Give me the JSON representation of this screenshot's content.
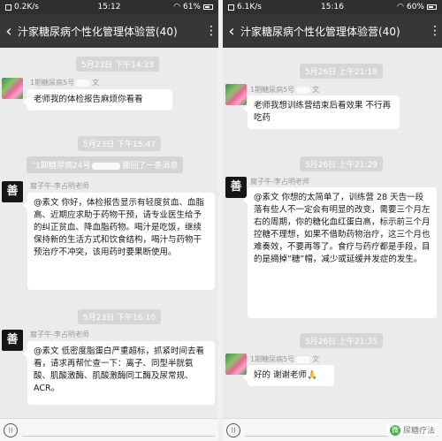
{
  "left": {
    "status_bar": {
      "network": "0.2K/s",
      "time": "15:12",
      "battery": "61%"
    },
    "title_bar": {
      "back": "‹",
      "title": "汁家糖尿病个性化管理体验营(40)",
      "menu": "⋮"
    },
    "messages": [
      {
        "type": "timestamp",
        "text": "5月23日 下午14:33"
      },
      {
        "type": "message",
        "sender_prefix": "1期糖尿病5号",
        "sender_suffix": "文",
        "text": "老师我的体检报告麻烦你看看"
      },
      {
        "type": "timestamp",
        "text": "5月23日 下午15:47"
      },
      {
        "type": "notice",
        "text_prefix": "\"1期糖尿病24号",
        "text_suffix": "撤回了一条消息"
      },
      {
        "type": "message",
        "sender": "腐子牛-李占明老师",
        "text": "@素文  你好，体检报告显示有轻度贫血、血脂高、近期应求助于药物干预，请专业医生给予的纠正贫血、降血脂药物。喝汁是吃饭，继续保持新的生活方式和饮食结构，喝汁与药物干预治疗不冲突，该用药时要果断使用。"
      },
      {
        "type": "timestamp",
        "text": "5月23日 下午16:10"
      },
      {
        "type": "message",
        "sender": "腐子牛-李占明老师",
        "text": "@素文  低密度脂蛋白严重超标，抓紧时间去看看，请求再帮忙查一下：离子、同型半胱氨酸、肌酸激酶、肌酸激酶同工酶及尿常规、ACR。"
      }
    ],
    "input_bar": {
      "voice_icon": "))"
    }
  },
  "right": {
    "status_bar": {
      "network": "6.1K/s",
      "time": "15:16",
      "battery": "60%"
    },
    "title_bar": {
      "back": "‹",
      "title": "汁家糖尿病个性化管理体验营(40)",
      "menu": "⋮"
    },
    "messages": [
      {
        "type": "timestamp",
        "text": "5月26日 上午21:18"
      },
      {
        "type": "message",
        "sender_prefix": "1期糖尿病5号",
        "sender_suffix": "文",
        "text": "老师我想训练营结束后看效果  不行再吃药"
      },
      {
        "type": "timestamp",
        "text": "5月26日 上午21:29"
      },
      {
        "type": "message",
        "sender": "腐子牛-李占明老师",
        "text": "@素文  你想的太简单了，训练营 28 天告一段落有些人不一定会有明显的改变，需要三个月左右的周期，你的糖化血红蛋白高，标示前三个月控糖不理想，如果不借助药物治疗，这三个月也难奏效，不要再等了。食疗与药疗都是手段，目的是摘掉“糖”帽，减少或延缓并发症的发生。"
      },
      {
        "type": "timestamp",
        "text": "5月26日 上午21:35"
      },
      {
        "type": "message",
        "sender_prefix": "1期糖尿病5号",
        "sender_suffix": "文",
        "text": "好的  谢谢老师🙏"
      }
    ],
    "input_bar": {
      "voice_icon": "))"
    },
    "watermark": {
      "icon": "微",
      "text": "尿糖疗法"
    }
  },
  "colors": {
    "title_bar": "#373737",
    "status_bar": "#2f2f2f",
    "chat_background": "#ebebeb",
    "bubble": "#ffffff",
    "timestamp_pill": "#d6d6d6"
  }
}
